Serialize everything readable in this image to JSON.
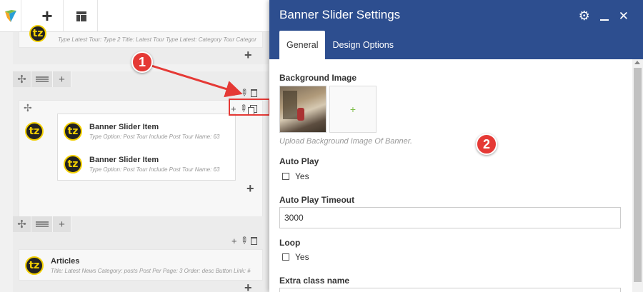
{
  "toolbar": {
    "logo_icon": "vc-logo-icon",
    "add_label": "+",
    "layout_icon": "layout-icon"
  },
  "rows": [
    {
      "item": {
        "meta": "Type Latest Tour: Type 2  Title: Latest Tour  Type Latest: Category  Tour Categor"
      },
      "add_label": "+"
    },
    {
      "add_label": "+",
      "inner_add_label": "+",
      "items": [
        {
          "title": "Banner Slider Item",
          "meta": "Type Option: Post Tour  Include Post Tour Name: 63",
          "logo_text": "tz"
        },
        {
          "title": "Banner Slider Item",
          "meta": "Type Option: Post Tour  Include Post Tour Name: 63",
          "logo_text": "tz"
        }
      ],
      "parent_logo_text": "tz"
    },
    {
      "item": {
        "title": "Articles",
        "meta": "Title: Latest News  Category: posts  Post Per Page: 3  Order: desc  Button Link: #",
        "logo_text": "tz"
      },
      "add_label": "+"
    }
  ],
  "annotations": {
    "badge_1": "1",
    "badge_2": "2",
    "color": "#e53935"
  },
  "modal": {
    "title": "Banner Slider Settings",
    "header_color": "#2d4e8f",
    "tabs": [
      {
        "label": "General",
        "active": true
      },
      {
        "label": "Design Options",
        "active": false
      }
    ],
    "fields": {
      "background_image": {
        "label": "Background Image",
        "add_label": "+",
        "help": "Upload Background Image Of Banner."
      },
      "auto_play": {
        "label": "Auto Play",
        "option": "Yes",
        "checked": false
      },
      "auto_play_timeout": {
        "label": "Auto Play Timeout",
        "value": "3000"
      },
      "loop": {
        "label": "Loop",
        "option": "Yes",
        "checked": false
      },
      "extra_class": {
        "label": "Extra class name"
      }
    }
  }
}
